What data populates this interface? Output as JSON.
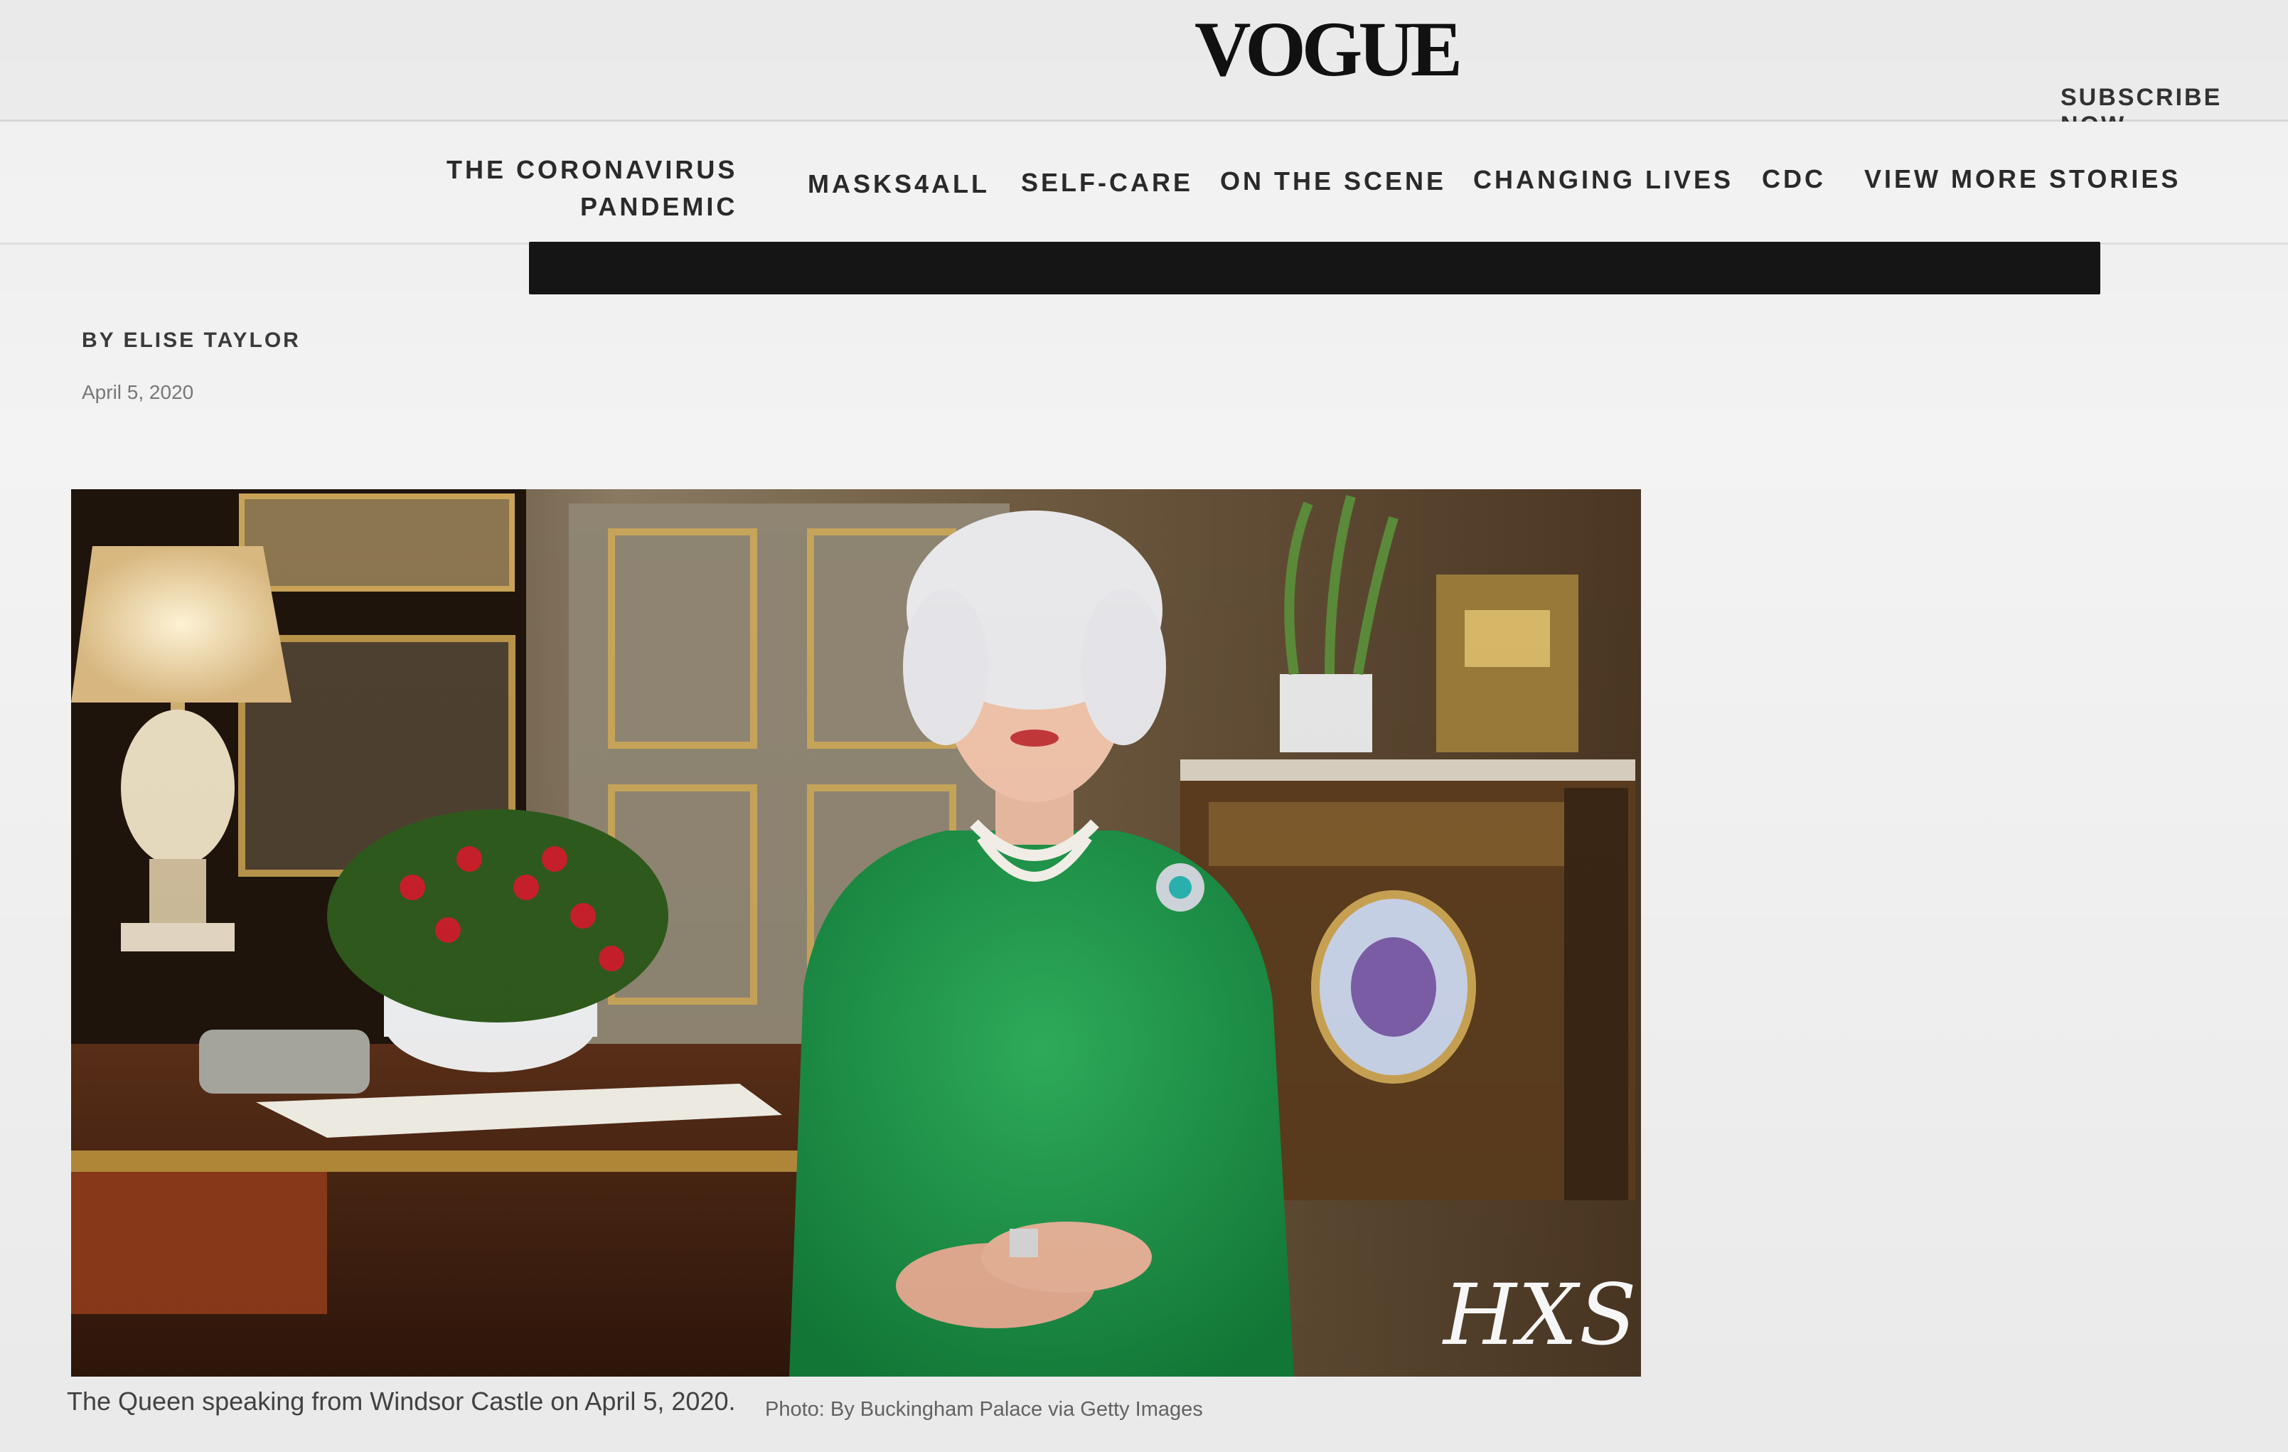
{
  "header": {
    "logo": "VOGUE",
    "subscribe_label": "SUBSCRIBE NOW"
  },
  "nav": {
    "items": [
      {
        "line1": "THE CORONAVIRUS",
        "line2": "PANDEMIC"
      },
      {
        "label": "MASKS4ALL"
      },
      {
        "label": "SELF-CARE"
      },
      {
        "label": "ON THE SCENE"
      },
      {
        "label": "CHANGING LIVES"
      },
      {
        "label": "CDC"
      },
      {
        "label": "VIEW MORE STORIES"
      }
    ]
  },
  "article": {
    "byline": "BY ELISE TAYLOR",
    "date": "April 5, 2020",
    "image": {
      "alt": "The Queen seated at a desk in a green dress in Windsor Castle",
      "watermark": "HXS..."
    },
    "caption": "The Queen speaking from Windsor Castle on April 5, 2020.",
    "credit": "Photo: By Buckingham Palace via Getty Images"
  }
}
